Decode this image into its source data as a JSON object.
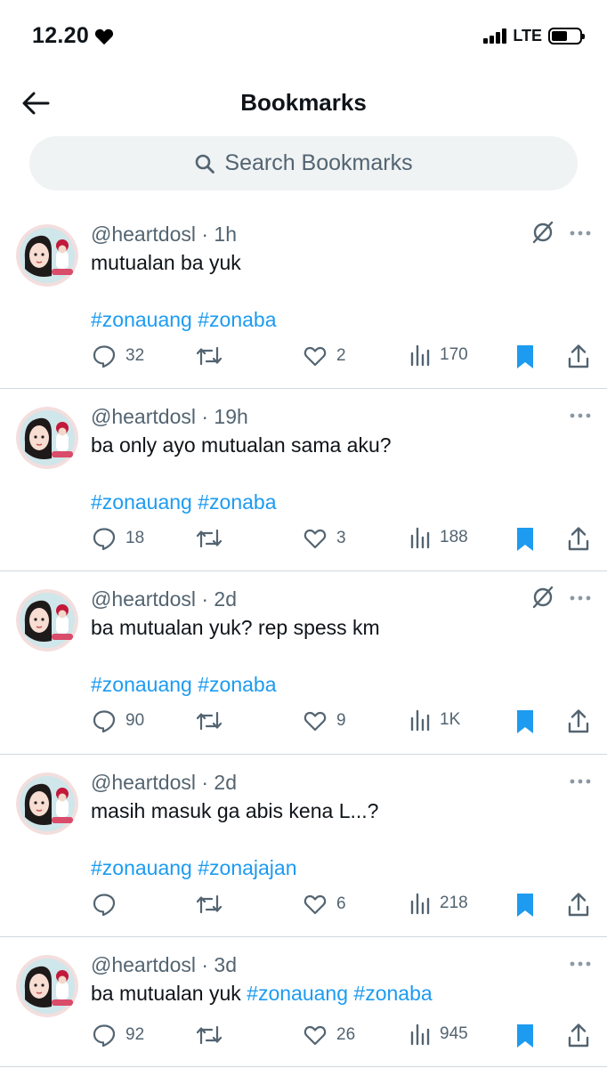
{
  "status_bar": {
    "time": "12.20",
    "network": "LTE"
  },
  "header": {
    "title": "Bookmarks"
  },
  "search": {
    "label": "Search Bookmarks"
  },
  "tweets": [
    {
      "handle": "@heartdosl",
      "time": "1h",
      "text": "mutualan ba yuk",
      "tags": [
        "#zonauang",
        "#zonaba"
      ],
      "replies": "32",
      "retweets": "",
      "likes": "2",
      "views": "170",
      "bookmarked": true,
      "has_hide_icon": true
    },
    {
      "handle": "@heartdosl",
      "time": "19h",
      "text": "ba only ayo mutualan sama aku?",
      "tags": [
        "#zonauang",
        "#zonaba"
      ],
      "replies": "18",
      "retweets": "",
      "likes": "3",
      "views": "188",
      "bookmarked": true,
      "has_hide_icon": false
    },
    {
      "handle": "@heartdosl",
      "time": "2d",
      "text": "ba mutualan yuk? rep spess km",
      "tags": [
        "#zonauang",
        "#zonaba"
      ],
      "replies": "90",
      "retweets": "",
      "likes": "9",
      "views": "1K",
      "bookmarked": true,
      "has_hide_icon": true
    },
    {
      "handle": "@heartdosl",
      "time": "2d",
      "text": "masih masuk ga abis kena L...?",
      "tags": [
        "#zonauang",
        "#zonajajan"
      ],
      "replies": "",
      "retweets": "",
      "likes": "6",
      "views": "218",
      "bookmarked": true,
      "has_hide_icon": false
    },
    {
      "handle": "@heartdosl",
      "time": "3d",
      "text": "ba mutualan yuk",
      "tags": [
        "#zonauang",
        "#zonaba"
      ],
      "inline_tags": true,
      "replies": "92",
      "retweets": "",
      "likes": "26",
      "views": "945",
      "bookmarked": true,
      "has_hide_icon": false
    }
  ],
  "colors": {
    "accent": "#1d9bf0",
    "muted": "#536471",
    "text": "#0f1419",
    "divider": "#cfd9de",
    "search_bg": "#eff3f4"
  }
}
